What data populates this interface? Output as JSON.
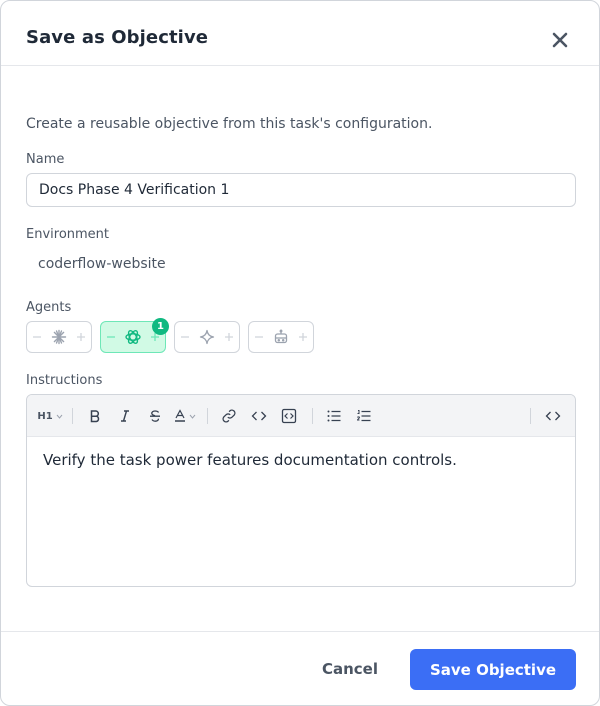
{
  "dialog": {
    "title": "Save as Objective",
    "description": "Create a reusable objective from this task's configuration."
  },
  "name": {
    "label": "Name",
    "value": "Docs Phase 4 Verification 1"
  },
  "environment": {
    "label": "Environment",
    "value": "coderflow-website"
  },
  "agents": {
    "label": "Agents",
    "items": [
      {
        "icon": "claude-burst-icon",
        "count": 0,
        "selected": false
      },
      {
        "icon": "openai-icon",
        "count": 1,
        "count_label": "1",
        "selected": true
      },
      {
        "icon": "sparkle-icon",
        "count": 0,
        "selected": false
      },
      {
        "icon": "robot-icon",
        "count": 0,
        "selected": false
      }
    ]
  },
  "instructions": {
    "label": "Instructions",
    "toolbar": {
      "heading_label": "H1",
      "items": [
        "heading-dropdown",
        "bold",
        "italic",
        "strikethrough",
        "text-color",
        "link",
        "inline-code",
        "code-block",
        "bullet-list",
        "numbered-list",
        "source-view"
      ]
    },
    "content": "Verify the task power features documentation controls."
  },
  "footer": {
    "cancel_label": "Cancel",
    "save_label": "Save Objective"
  },
  "colors": {
    "primary": "#3b6ef5",
    "agent_selected_bg": "#d1fae5",
    "badge": "#10b981"
  }
}
